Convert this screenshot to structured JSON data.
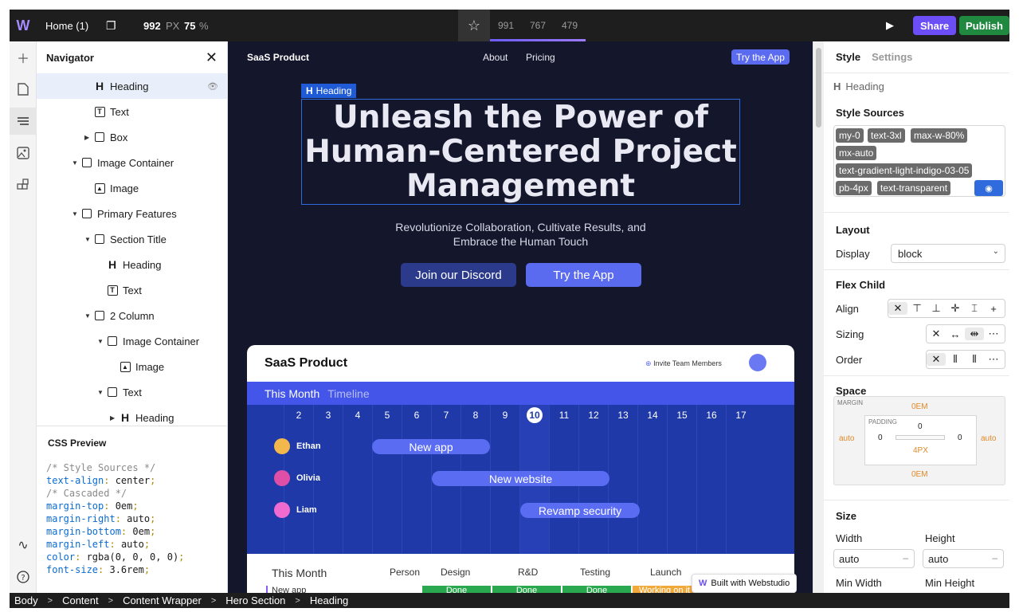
{
  "topbar": {
    "page_name": "Home (1)",
    "width_value": "992",
    "width_unit": "PX",
    "zoom_value": "75",
    "zoom_unit": "%",
    "breakpoints": [
      "991",
      "767",
      "479"
    ],
    "share_label": "Share",
    "publish_label": "Publish"
  },
  "navigator": {
    "title": "Navigator",
    "items": [
      {
        "label": "Heading"
      },
      {
        "label": "Text"
      },
      {
        "label": "Box"
      },
      {
        "label": "Image Container"
      },
      {
        "label": "Image"
      },
      {
        "label": "Primary Features"
      },
      {
        "label": "Section Title"
      },
      {
        "label": "Heading"
      },
      {
        "label": "Text"
      },
      {
        "label": "2 Column"
      },
      {
        "label": "Image Container"
      },
      {
        "label": "Image"
      },
      {
        "label": "Text"
      },
      {
        "label": "Heading"
      }
    ]
  },
  "css_preview": {
    "title": "CSS Preview",
    "comment_sources": "/* Style Sources */",
    "comment_cascaded": "/* Cascaded */",
    "lines": [
      {
        "prop": "text-align",
        "val": "center"
      },
      {
        "prop": "margin-top",
        "val": "0em"
      },
      {
        "prop": "margin-right",
        "val": "auto"
      },
      {
        "prop": "margin-bottom",
        "val": "0em"
      },
      {
        "prop": "margin-left",
        "val": "auto"
      },
      {
        "prop": "color",
        "val": "rgba(0, 0, 0, 0)"
      },
      {
        "prop": "font-size",
        "val": "3.6rem"
      }
    ]
  },
  "canvas": {
    "nav_brand": "SaaS Product",
    "nav_about": "About",
    "nav_pricing": "Pricing",
    "nav_try": "Try the App",
    "selected_label": "Heading",
    "hero_line1": "Unleash the Power of",
    "hero_line2": "Human-Centered Project",
    "hero_line3": "Management",
    "hero_sub1": "Revolutionize Collaboration, Cultivate Results, and",
    "hero_sub2": "Embrace the Human Touch",
    "btn_discord": "Join our Discord",
    "btn_try": "Try the App",
    "app_title": "SaaS Product",
    "app_invite": "Invite Team Members",
    "bar_month": "This Month",
    "bar_timeline": "Timeline",
    "days": [
      "2",
      "3",
      "4",
      "5",
      "6",
      "7",
      "8",
      "9",
      "10",
      "11",
      "12",
      "13",
      "14",
      "15",
      "16",
      "17"
    ],
    "today": "10",
    "people": [
      {
        "name": "Ethan",
        "task": "New app"
      },
      {
        "name": "Olivia",
        "task": "New website"
      },
      {
        "name": "Liam",
        "task": "Revamp security"
      }
    ],
    "table_headers": [
      "This Month",
      "Person",
      "Design",
      "R&D",
      "Testing",
      "Launch"
    ],
    "table_row_label": "New app",
    "done_label": "Done",
    "working_label": "Working on it",
    "built_with": "Built with Webstudio"
  },
  "style_panel": {
    "tab_style": "Style",
    "tab_settings": "Settings",
    "element": "Heading",
    "sources_title": "Style Sources",
    "chips": [
      "my-0",
      "text-3xl",
      "max-w-80%",
      "mx-auto",
      "text-gradient-light-indigo-03-05",
      "pb-4px",
      "text-transparent"
    ],
    "layout_title": "Layout",
    "display_label": "Display",
    "display_value": "block",
    "flex_title": "Flex Child",
    "align_label": "Align",
    "sizing_label": "Sizing",
    "order_label": "Order",
    "space_title": "Space",
    "margin_label": "MARGIN",
    "padding_label": "PADDING",
    "margin_top": "0EM",
    "margin_bottom": "0EM",
    "margin_left": "auto",
    "margin_right": "auto",
    "padding_top": "0",
    "padding_left": "0",
    "padding_right": "0",
    "padding_bottom": "4PX",
    "size_title": "Size",
    "width_label": "Width",
    "height_label": "Height",
    "width_value": "auto",
    "height_value": "auto",
    "minwidth_label": "Min Width",
    "minheight_label": "Min Height"
  },
  "breadcrumbs": [
    "Body",
    "Content",
    "Content Wrapper",
    "Hero Section",
    "Heading"
  ],
  "colors": {
    "accent": "#6b4ef6",
    "publish": "#1f8a3f",
    "selection": "#2f6bdc",
    "canvas_bg": "#14162b"
  }
}
